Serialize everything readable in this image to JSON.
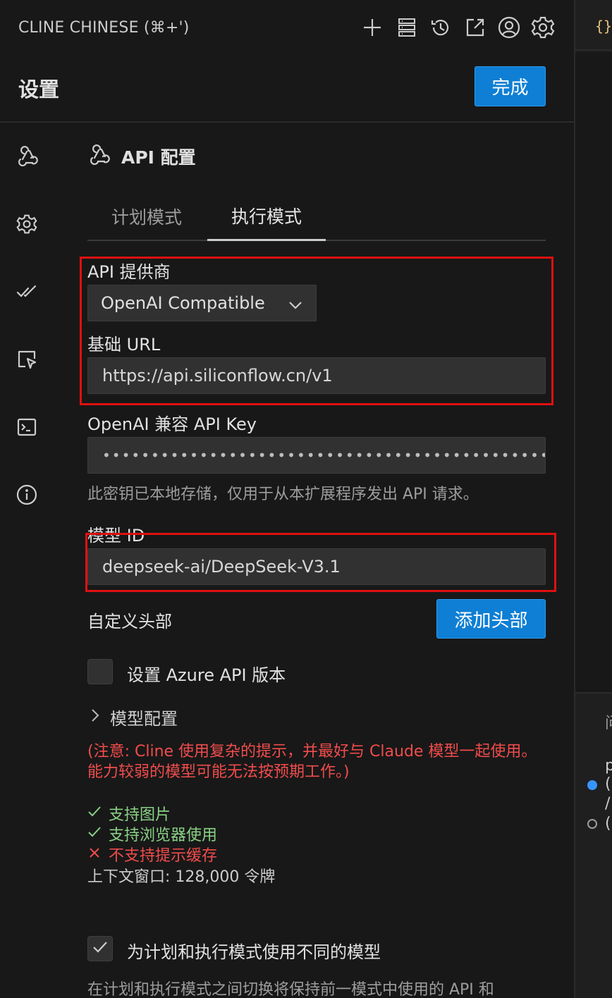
{
  "titlebar": {
    "app_title": "CLINE CHINESE (⌘+')",
    "icons": [
      "plus-icon",
      "server-icon",
      "history-icon",
      "popout-icon",
      "account-icon",
      "gear-icon"
    ]
  },
  "header": {
    "title": "设置",
    "done_label": "完成"
  },
  "nav": {
    "items": [
      "webhook-icon",
      "gear-icon",
      "check-all-icon",
      "browser-icon",
      "terminal-icon",
      "info-icon"
    ]
  },
  "api_config": {
    "section_title": "API 配置",
    "tabs": [
      {
        "label": "计划模式",
        "active": false
      },
      {
        "label": "执行模式",
        "active": true
      }
    ],
    "provider_label": "API 提供商",
    "provider_value": "OpenAI Compatible",
    "base_url_label": "基础 URL",
    "base_url_value": "https://api.siliconflow.cn/v1",
    "api_key_label": "OpenAI 兼容 API Key",
    "api_key_value": "••••••••••••••••••••••••••••••••••••••••••••••••••••",
    "api_key_help": "此密钥已本地存储，仅用于从本扩展程序发出 API 请求。",
    "model_id_label": "模型 ID",
    "model_id_value": "deepseek-ai/DeepSeek-V3.1",
    "custom_headers_label": "自定义头部",
    "add_header_label": "添加头部",
    "azure_label": "设置 Azure API 版本",
    "azure_checked": false,
    "model_config_label": "模型配置",
    "warning_text": "(注意: Cline 使用复杂的提示，并最好与 Claude 模型一起使用。 能力较弱的模型可能无法按预期工作。)",
    "features": [
      {
        "label": "支持图片",
        "supported": true
      },
      {
        "label": "支持浏览器使用",
        "supported": true
      },
      {
        "label": "不支持提示缓存",
        "supported": false
      }
    ],
    "context_window": "上下文窗口: 128,000 令牌",
    "separate_models_label": "为计划和执行模式使用不同的模型",
    "separate_models_checked": true,
    "separate_models_desc": "在计划和执行模式之间切换将保持前一模式中使用的 API 和"
  },
  "right_pane": {
    "brace": "{}",
    "snippet_1": "问",
    "snippet_2": "p",
    "snippet_3": "(",
    "snippet_4": "/",
    "snippet_5": "("
  },
  "colors": {
    "accent": "#0e7fd4",
    "highlight_box": "#e01010",
    "ok": "#89d185",
    "error": "#f14c4c"
  }
}
